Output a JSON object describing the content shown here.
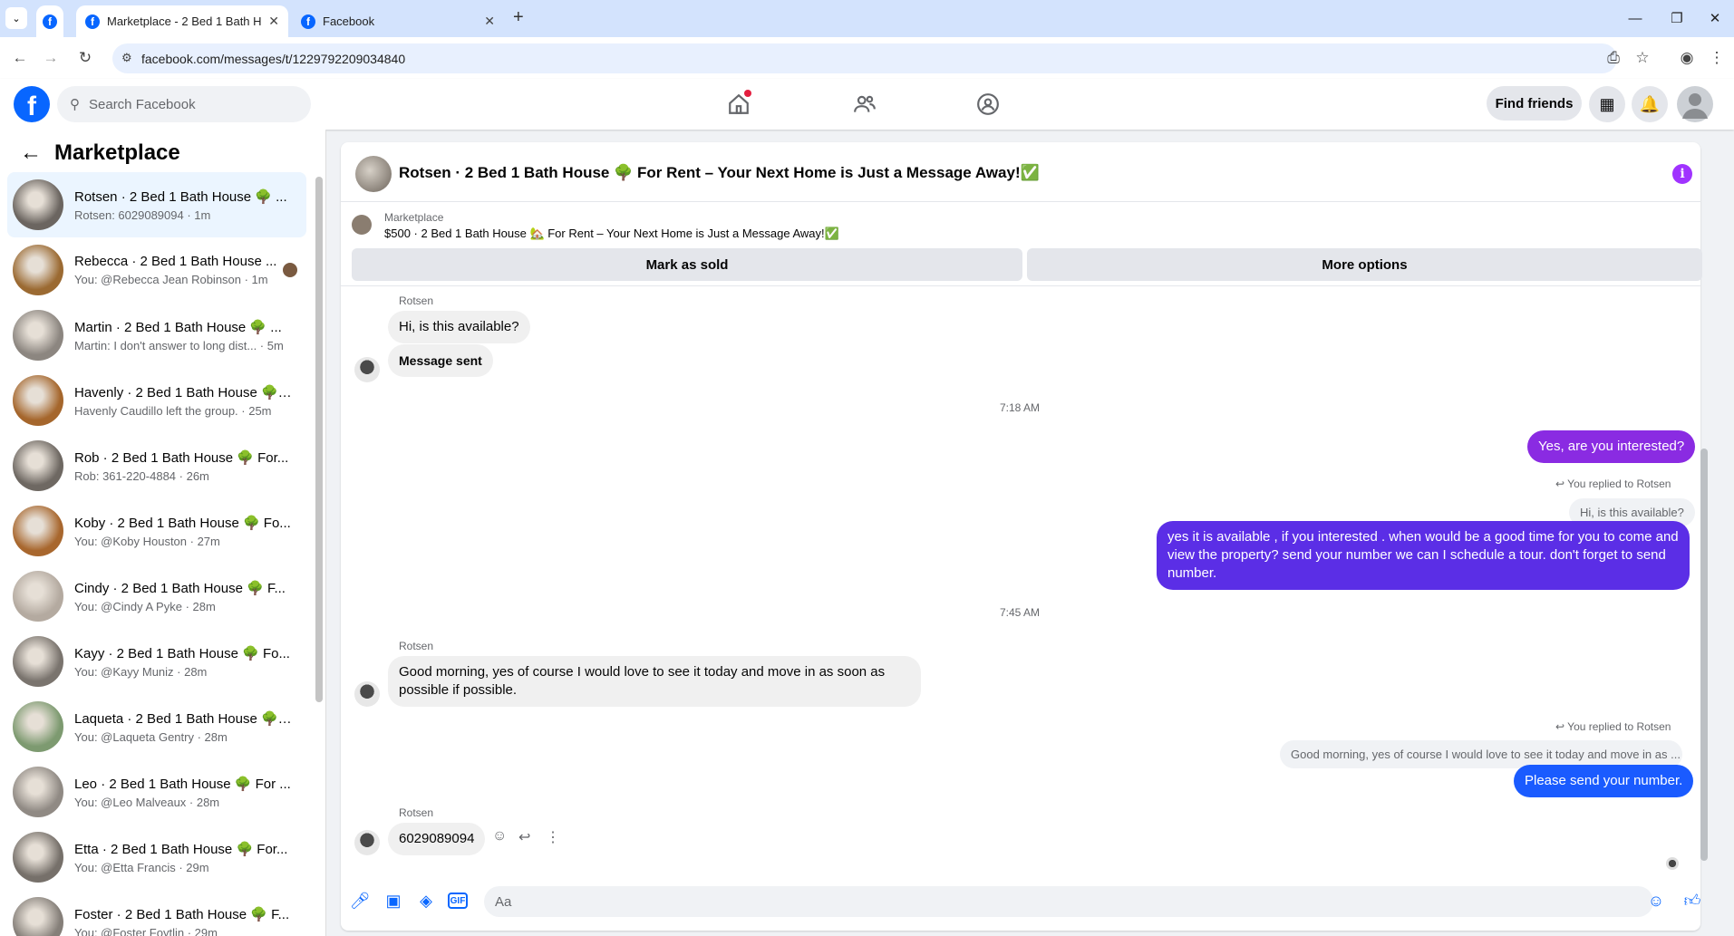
{
  "browser": {
    "tabs": [
      {
        "title": "Marketplace - 2 Bed 1 Bath Ho",
        "close": "✕"
      },
      {
        "title": "Facebook",
        "close": "✕"
      }
    ],
    "new_tab": "+",
    "url": "facebook.com/messages/t/1229792209034840",
    "window_controls": {
      "minimize": "—",
      "restore": "❐",
      "close": "✕"
    }
  },
  "header": {
    "search_placeholder": "Search Facebook",
    "find_friends": "Find friends",
    "nav_icons": [
      "home-icon",
      "friends-icon",
      "groups-icon"
    ]
  },
  "sidebar": {
    "title": "Marketplace",
    "conversations": [
      {
        "name": "Rotsen · 2 Bed 1 Bath House 🌳 ...",
        "preview": "Rotsen: 6029089094 · 1m",
        "thumb": "#6b6560"
      },
      {
        "name": "Rebecca · 2 Bed 1 Bath House ...",
        "preview": "You: @Rebecca Jean Robinson · 1m",
        "thumb": "#9b6a32"
      },
      {
        "name": "Martin · 2 Bed 1 Bath House 🌳 ...",
        "preview": "Martin: I don't answer to long dist... · 5m",
        "thumb": "#8c8680"
      },
      {
        "name": "Havenly · 2 Bed 1 Bath House 🌳 ...",
        "preview": "Havenly Caudillo left the group. · 25m",
        "thumb": "#a5662c"
      },
      {
        "name": "Rob · 2 Bed 1 Bath House 🌳 For...",
        "preview": "Rob: 361-220-4884 · 26m",
        "thumb": "#6e6862"
      },
      {
        "name": "Koby · 2 Bed 1 Bath House 🌳 Fo...",
        "preview": "You: @Koby Houston · 27m",
        "thumb": "#a8672e"
      },
      {
        "name": "Cindy · 2 Bed 1 Bath House 🌳 F...",
        "preview": "You: @Cindy A Pyke · 28m",
        "thumb": "#b4aaa0"
      },
      {
        "name": "Kayy · 2 Bed 1 Bath House 🌳 Fo...",
        "preview": "You: @Kayy Muniz · 28m",
        "thumb": "#7a746e"
      },
      {
        "name": "Laqueta · 2 Bed 1 Bath House 🌳 ...",
        "preview": "You: @Laqueta Gentry · 28m",
        "thumb": "#7d9a70"
      },
      {
        "name": "Leo · 2 Bed 1 Bath House 🌳 For ...",
        "preview": "You: @Leo Malveaux · 28m",
        "thumb": "#908a84"
      },
      {
        "name": "Etta · 2 Bed 1 Bath House 🌳 For...",
        "preview": "You: @Etta Francis · 29m",
        "thumb": "#76706a"
      },
      {
        "name": "Foster · 2 Bed 1 Bath House 🌳 F...",
        "preview": "You: @Foster Foytlin · 29m",
        "thumb": "#857f79"
      }
    ]
  },
  "chat": {
    "title": "Rotsen · 2 Bed 1 Bath House 🌳 For Rent – Your Next Home is Just a Message Away!✅",
    "info": "i",
    "marketplace_label": "Marketplace",
    "marketplace_item": "$500 · 2 Bed 1 Bath House 🏡 For Rent – Your Next Home is Just a Message Away!✅",
    "mark_sold": "Mark as sold",
    "more_options": "More options",
    "messages": {
      "sender1": "Rotsen",
      "m1": "Hi, is this available?",
      "m2": "Message sent",
      "time1": "7:18 AM",
      "m3": "Yes, are you interested?",
      "replied1": "You replied to Rotsen",
      "quote1": "Hi, is this available?",
      "m4": "yes it is available , if you interested . when would be  a good time for you to come and view the  property? send your number we can I schedule  a tour. don't forget to send  number.",
      "time2": "7:45 AM",
      "sender2": "Rotsen",
      "m5": "Good morning, yes of course I would love to see it today and move in as soon as possible if possible.",
      "replied2": "You replied to Rotsen",
      "quote2": "Good morning, yes of course I would love to see it today and move in as ...",
      "m6": "Please send your number.",
      "sender3": "Rotsen",
      "m7": "6029089094"
    },
    "composer_placeholder": "Aa"
  },
  "colors": {
    "brand": "#0866ff",
    "outgoing": "#1a5bff",
    "accent": "#a033ff"
  }
}
